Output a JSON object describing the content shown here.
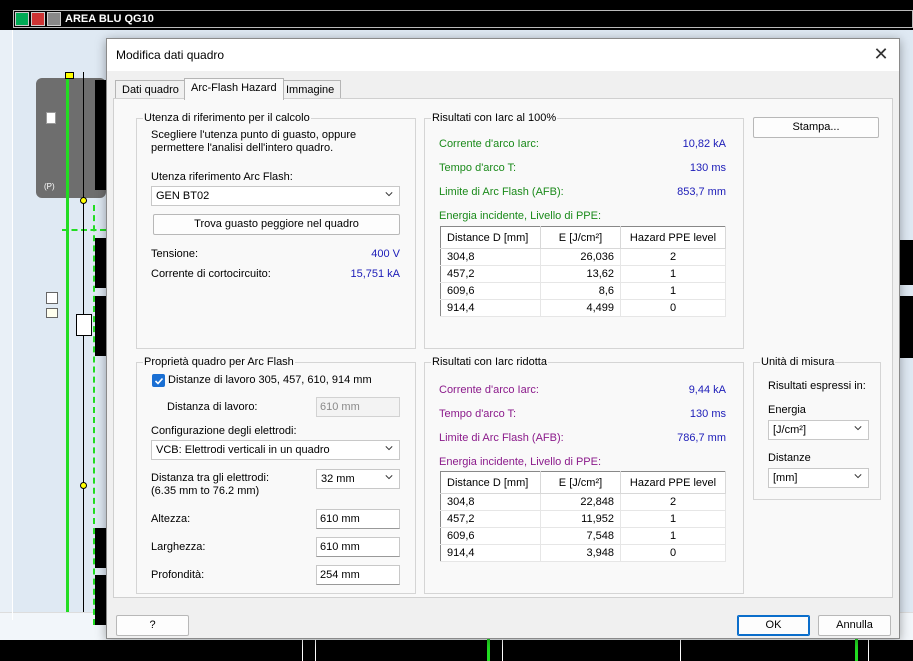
{
  "background": {
    "title": "AREA BLU QG10",
    "panel_label": "(P)"
  },
  "dialog": {
    "title": "Modifica dati quadro",
    "close_glyph": "✕",
    "tabs": [
      {
        "label": "Dati quadro",
        "active": false
      },
      {
        "label": "Arc-Flash Hazard",
        "active": true
      },
      {
        "label": "Immagine",
        "active": false
      }
    ],
    "reference": {
      "group_title": "Utenza di riferimento per il calcolo",
      "description_line1": "Scegliere l'utenza punto di guasto, oppure",
      "description_line2": "permettere l'analisi dell'intero quadro.",
      "arcflash_label": "Utenza riferimento Arc Flash:",
      "arcflash_value": "GEN BT02",
      "find_button": "Trova guasto peggiore nel quadro",
      "voltage_label": "Tensione:",
      "voltage_value": "400 V",
      "shortcircuit_label": "Corrente di cortocircuito:",
      "shortcircuit_value": "15,751 kA"
    },
    "results_100": {
      "group_title": "Risultati con Iarc al 100%",
      "arc_current_label": "Corrente d'arco Iarc:",
      "arc_current_value": "10,82 kA",
      "arc_time_label": "Tempo d'arco T:",
      "arc_time_value": "130 ms",
      "afb_label": "Limite di Arc Flash (AFB):",
      "afb_value": "853,7 mm",
      "energy_label": "Energia incidente, Livello di PPE:",
      "headers": [
        "Distance D [mm]",
        "E [J/cm²]",
        "Hazard PPE level"
      ],
      "rows": [
        [
          "304,8",
          "26,036",
          "2"
        ],
        [
          "457,2",
          "13,62",
          "1"
        ],
        [
          "609,6",
          "8,6",
          "1"
        ],
        [
          "914,4",
          "4,499",
          "0"
        ]
      ]
    },
    "print_button": "Stampa...",
    "properties": {
      "group_title": "Proprietà quadro per Arc Flash",
      "distances_checkbox_label": "Distanze di lavoro 305, 457, 610, 914 mm",
      "distances_checked": true,
      "working_distance_label": "Distanza di lavoro:",
      "working_distance_value": "610 mm",
      "electrode_config_label": "Configurazione degli elettrodi:",
      "electrode_config_value": "VCB: Elettrodi verticali in un quadro",
      "gap_label_line1": "Distanza tra gli elettrodi:",
      "gap_label_line2": "(6.35 mm to 76.2 mm)",
      "gap_value": "32 mm",
      "height_label": "Altezza:",
      "height_value": "610 mm",
      "width_label": "Larghezza:",
      "width_value": "610 mm",
      "depth_label": "Profondità:",
      "depth_value": "254 mm"
    },
    "results_reduced": {
      "group_title": "Risultati con Iarc ridotta",
      "arc_current_label": "Corrente d'arco Iarc:",
      "arc_current_value": "9,44 kA",
      "arc_time_label": "Tempo d'arco T:",
      "arc_time_value": "130 ms",
      "afb_label": "Limite di Arc Flash (AFB):",
      "afb_value": "786,7 mm",
      "energy_label": "Energia incidente, Livello di PPE:",
      "headers": [
        "Distance D [mm]",
        "E [J/cm²]",
        "Hazard PPE level"
      ],
      "rows": [
        [
          "304,8",
          "22,848",
          "2"
        ],
        [
          "457,2",
          "11,952",
          "1"
        ],
        [
          "609,6",
          "7,548",
          "1"
        ],
        [
          "914,4",
          "3,948",
          "0"
        ]
      ]
    },
    "units": {
      "group_title": "Unità di misura",
      "results_label": "Risultati espressi in:",
      "energy_label": "Energia",
      "energy_value": "[J/cm²]",
      "distance_label": "Distanze",
      "distance_value": "[mm]"
    },
    "help_button": "?",
    "ok_button": "OK",
    "cancel_button": "Annulla"
  }
}
